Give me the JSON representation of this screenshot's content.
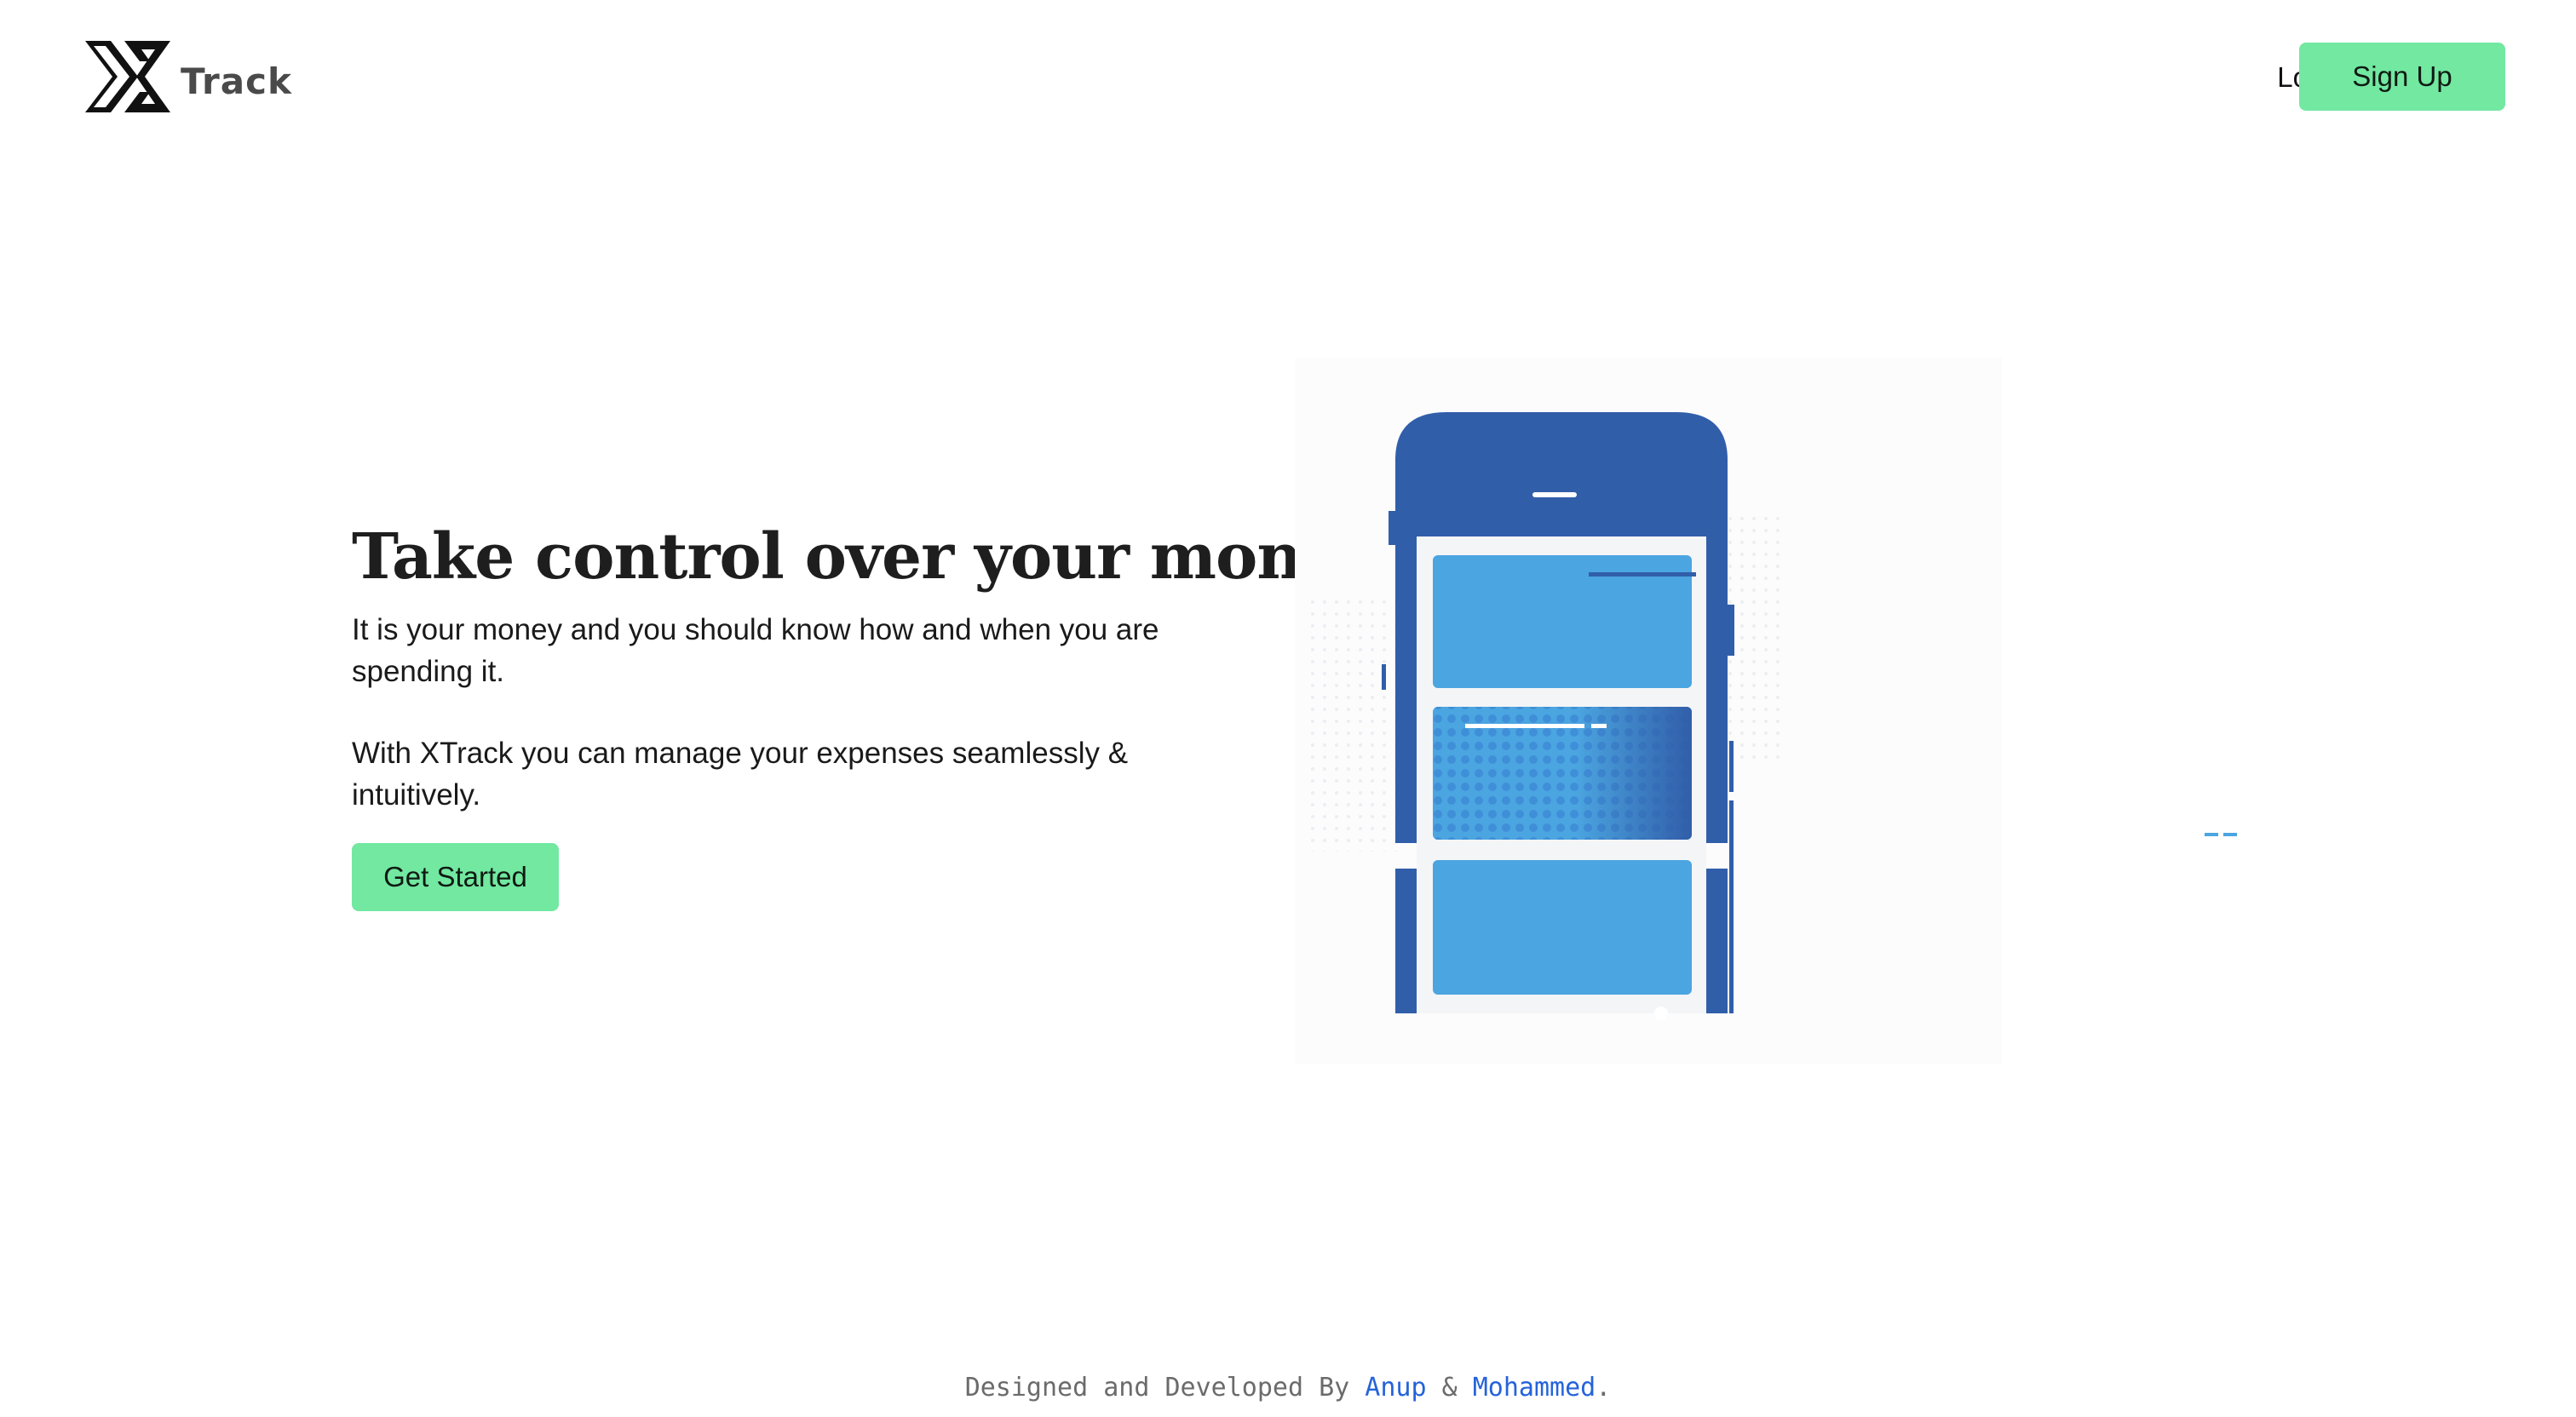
{
  "header": {
    "logo_text": "Track",
    "login_label": "Login",
    "signup_label": "Sign Up"
  },
  "hero": {
    "title": "Take control over your money",
    "paragraph1": "It is your money and you should know how and when you are spending it.",
    "paragraph2": "With XTrack you can manage your expenses seamlessly & intuitively.",
    "cta_label": "Get Started"
  },
  "footer": {
    "prefix": "Designed and Developed By ",
    "author1": "Anup",
    "separator": " & ",
    "author2": "Mohammed",
    "suffix": "."
  },
  "colors": {
    "accent_green": "#72e8a1",
    "phone_dark_blue": "#315ea9",
    "phone_light_blue": "#4ba5e0",
    "link_blue": "#2563d9"
  },
  "icons": {
    "logo": "xtrack-logo-icon",
    "illustration": "phone-app-illustration"
  }
}
